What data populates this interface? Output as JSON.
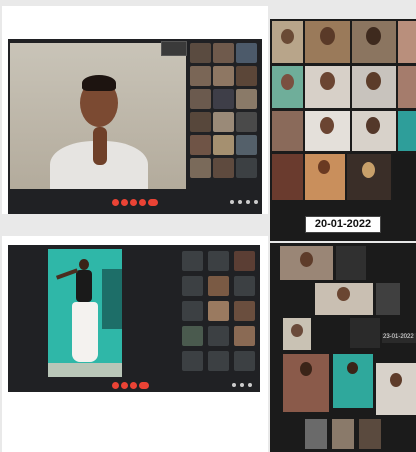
{
  "date_labels": {
    "first": "20-01-2022",
    "second": "23-01-2022"
  },
  "call_one": {
    "speaker_caption": "",
    "self_view_caption": ""
  },
  "call_two": {
    "speaker_caption": ""
  },
  "colors": {
    "meet_bg": "#202124",
    "end_call": "#ea4335",
    "teal_wall": "#2fb7a8"
  }
}
